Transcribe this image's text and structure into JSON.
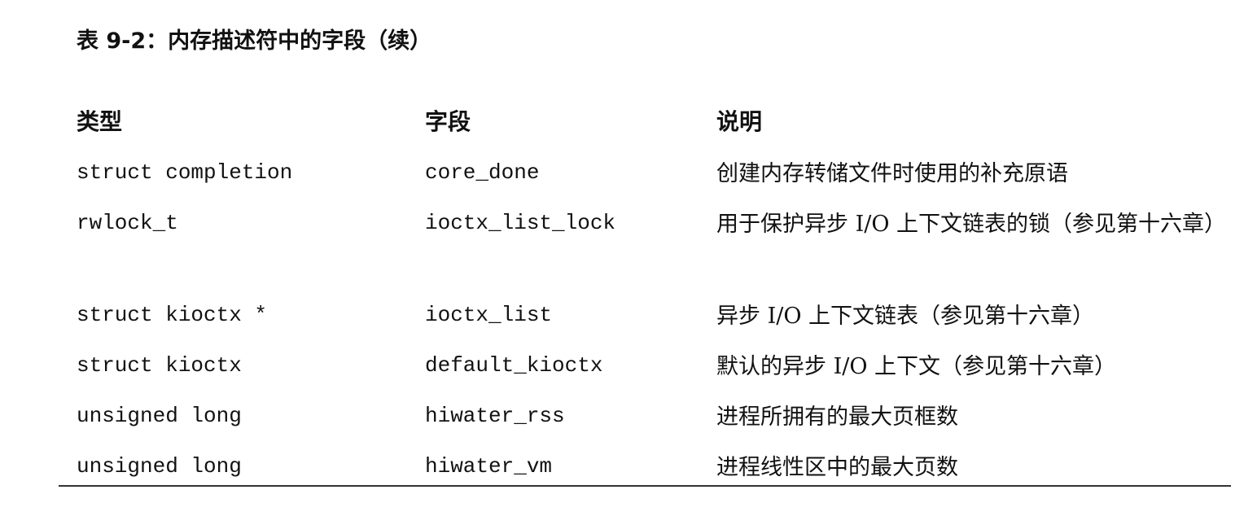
{
  "table": {
    "caption": "表 9-2：内存描述符中的字段（续）",
    "headers": [
      "类型",
      "字段",
      "说明"
    ],
    "rows": [
      {
        "type": "struct completion",
        "field": "core_done",
        "description": "创建内存转储文件时使用的补充原语"
      },
      {
        "type": "rwlock_t",
        "field": "ioctx_list_lock",
        "description": "用于保护异步 I/O 上下文链表的锁（参见第十六章）"
      },
      {
        "type": "struct kioctx *",
        "field": "ioctx_list",
        "description": "异步 I/O 上下文链表（参见第十六章）"
      },
      {
        "type": "struct kioctx",
        "field": "default_kioctx",
        "description": "默认的异步 I/O 上下文（参见第十六章）"
      },
      {
        "type": "unsigned long",
        "field": "hiwater_rss",
        "description": "进程所拥有的最大页框数"
      },
      {
        "type": "unsigned long",
        "field": "hiwater_vm",
        "description": "进程线性区中的最大页数"
      }
    ]
  }
}
